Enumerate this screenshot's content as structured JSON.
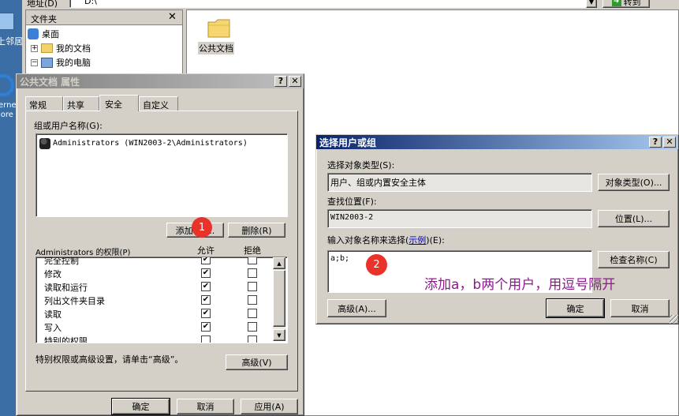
{
  "explorer": {
    "address_label": "地址(D)",
    "address_value": "D:\\",
    "go_label": "转到",
    "folders_pane_title": "文件夹",
    "tree": [
      {
        "label": "桌面",
        "expander": ""
      },
      {
        "label": "我的文档",
        "expander": "+"
      },
      {
        "label": "我的电脑",
        "expander": "−"
      }
    ],
    "folder_item_label": "公共文档"
  },
  "desktop": {
    "icon1_label": "上邻居",
    "icon2_label_line1": "erne",
    "icon2_label_line2": "lore"
  },
  "properties_dialog": {
    "title": "公共文档 属性",
    "tabs": [
      "常规",
      "共享",
      "安全",
      "自定义"
    ],
    "active_tab": "安全",
    "group_label": "组或用户名称(G):",
    "users": [
      "Administrators (WIN2003-2\\Administrators)"
    ],
    "add_button": "添加(D)...",
    "remove_button": "删除(R)",
    "perm_label": "Administrators 的权限(P)",
    "allow_header": "允许",
    "deny_header": "拒绝",
    "permissions": [
      {
        "name": "完全控制",
        "allow": "✔",
        "deny": ""
      },
      {
        "name": "修改",
        "allow": "✔",
        "deny": ""
      },
      {
        "name": "读取和运行",
        "allow": "✔",
        "deny": ""
      },
      {
        "name": "列出文件夹目录",
        "allow": "✔",
        "deny": ""
      },
      {
        "name": "读取",
        "allow": "✔",
        "deny": ""
      },
      {
        "name": "写入",
        "allow": "✔",
        "deny": ""
      },
      {
        "name": "特别的权限",
        "allow": "",
        "deny": ""
      }
    ],
    "special_text": "特别权限或高级设置，请单击“高级”。",
    "advanced_button": "高级(V)",
    "ok_button": "确定",
    "cancel_button": "取消",
    "apply_button": "应用(A)"
  },
  "select_dialog": {
    "title": "选择用户或组",
    "object_type_label": "选择对象类型(S):",
    "object_type_value": "用户、组或内置安全主体",
    "object_type_button": "对象类型(O)...",
    "location_label": "查找位置(F):",
    "location_value": "WIN2003-2",
    "location_button": "位置(L)...",
    "names_label_prefix": "输入对象名称来选择(",
    "names_label_link": "示例",
    "names_label_suffix": ")(E):",
    "names_value": "a;b;",
    "check_names_button": "检查名称(C)",
    "advanced_button": "高级(A)...",
    "ok_button": "确定",
    "cancel_button": "取消"
  },
  "annotations": {
    "marker1": "1",
    "marker2": "2",
    "note": "添加a，b两个用户，用逗号隔开",
    "marker_color": "#e8322a",
    "note_color": "#8b1a8b"
  }
}
